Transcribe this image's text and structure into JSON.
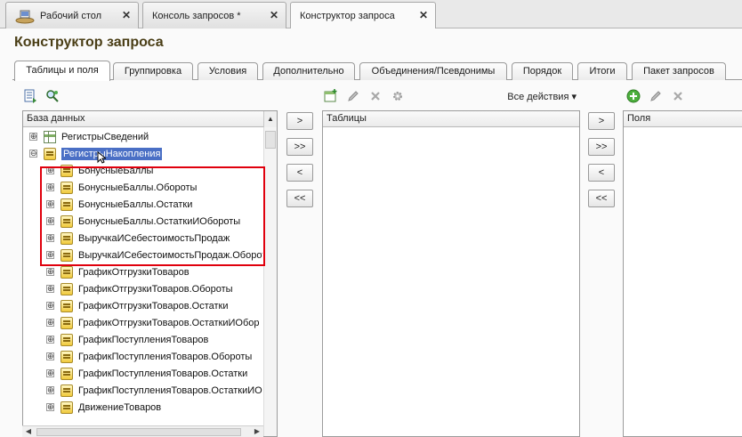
{
  "window_tabs": [
    {
      "label": "Рабочий стол",
      "close": "✕"
    },
    {
      "label": "Консоль запросов *",
      "close": "✕"
    },
    {
      "label": "Конструктор запроса",
      "close": "✕"
    }
  ],
  "page_title": "Конструктор запроса",
  "inner_tabs": [
    "Таблицы и поля",
    "Группировка",
    "Условия",
    "Дополнительно",
    "Объединения/Псевдонимы",
    "Порядок",
    "Итоги",
    "Пакет запросов"
  ],
  "all_actions": "Все действия ▾",
  "panels": {
    "database": "База данных",
    "tables": "Таблицы",
    "fields": "Поля"
  },
  "transfer_buttons": [
    ">",
    ">>",
    "<",
    "<<"
  ],
  "tree": [
    {
      "label": "РегистрыСведений",
      "exp": "⊕",
      "icon": "table"
    },
    {
      "label": "РегистрыНакопления",
      "exp": "⊖",
      "icon": "reg"
    },
    {
      "label": "БонусныеБаллы",
      "exp": "⊕",
      "icon": "reg"
    },
    {
      "label": "БонусныеБаллы.Обороты",
      "exp": "⊕",
      "icon": "reg"
    },
    {
      "label": "БонусныеБаллы.Остатки",
      "exp": "⊕",
      "icon": "reg"
    },
    {
      "label": "БонусныеБаллы.ОстаткиИОбороты",
      "exp": "⊕",
      "icon": "reg"
    },
    {
      "label": "ВыручкаИСебестоимостьПродаж",
      "exp": "⊕",
      "icon": "reg"
    },
    {
      "label": "ВыручкаИСебестоимостьПродаж.Оборот",
      "exp": "⊕",
      "icon": "reg"
    },
    {
      "label": "ГрафикОтгрузкиТоваров",
      "exp": "⊕",
      "icon": "reg"
    },
    {
      "label": "ГрафикОтгрузкиТоваров.Обороты",
      "exp": "⊕",
      "icon": "reg"
    },
    {
      "label": "ГрафикОтгрузкиТоваров.Остатки",
      "exp": "⊕",
      "icon": "reg"
    },
    {
      "label": "ГрафикОтгрузкиТоваров.ОстаткиИОбор",
      "exp": "⊕",
      "icon": "reg"
    },
    {
      "label": "ГрафикПоступленияТоваров",
      "exp": "⊕",
      "icon": "reg"
    },
    {
      "label": "ГрафикПоступленияТоваров.Обороты",
      "exp": "⊕",
      "icon": "reg"
    },
    {
      "label": "ГрафикПоступленияТоваров.Остатки",
      "exp": "⊕",
      "icon": "reg"
    },
    {
      "label": "ГрафикПоступленияТоваров.ОстаткиИО",
      "exp": "⊕",
      "icon": "reg"
    },
    {
      "label": "ДвижениеТоваров",
      "exp": "⊕",
      "icon": "reg"
    }
  ],
  "scroll": {
    "up": "▲",
    "left": "◀",
    "right": "▶"
  },
  "colors": {
    "title": "#4a3e16",
    "selection": "#4a6fc5",
    "highlight": "#e0000d"
  }
}
